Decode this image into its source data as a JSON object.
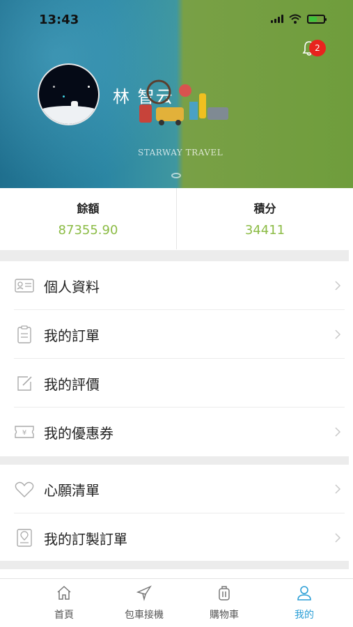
{
  "status_bar": {
    "time": "13:43"
  },
  "header": {
    "notification_count": "2",
    "username": "林 智云",
    "brand_text": "STARWAY TRAVEL"
  },
  "stats": {
    "balance_label": "餘額",
    "balance_value": "87355.90",
    "points_label": "積分",
    "points_value": "34411"
  },
  "menu": {
    "group1": [
      {
        "label": "個人資料",
        "icon": "id-card-icon",
        "has_chevron": true
      },
      {
        "label": "我的訂單",
        "icon": "clipboard-icon",
        "has_chevron": true
      },
      {
        "label": "我的評價",
        "icon": "edit-icon",
        "has_chevron": false
      },
      {
        "label": "我的優惠券",
        "icon": "coupon-icon",
        "has_chevron": true
      }
    ],
    "group2": [
      {
        "label": "心願清單",
        "icon": "heart-icon",
        "has_chevron": true
      },
      {
        "label": "我的訂製訂單",
        "icon": "map-pin-book-icon",
        "has_chevron": true
      }
    ]
  },
  "tabs": [
    {
      "label": "首頁",
      "icon": "home-icon",
      "active": false
    },
    {
      "label": "包車接機",
      "icon": "airplane-icon",
      "active": false
    },
    {
      "label": "購物車",
      "icon": "luggage-icon",
      "active": false
    },
    {
      "label": "我的",
      "icon": "user-icon",
      "active": true
    }
  ],
  "colors": {
    "accent_green": "#8bbb44",
    "accent_blue": "#2a9ed6",
    "badge_red": "#e8231e"
  }
}
